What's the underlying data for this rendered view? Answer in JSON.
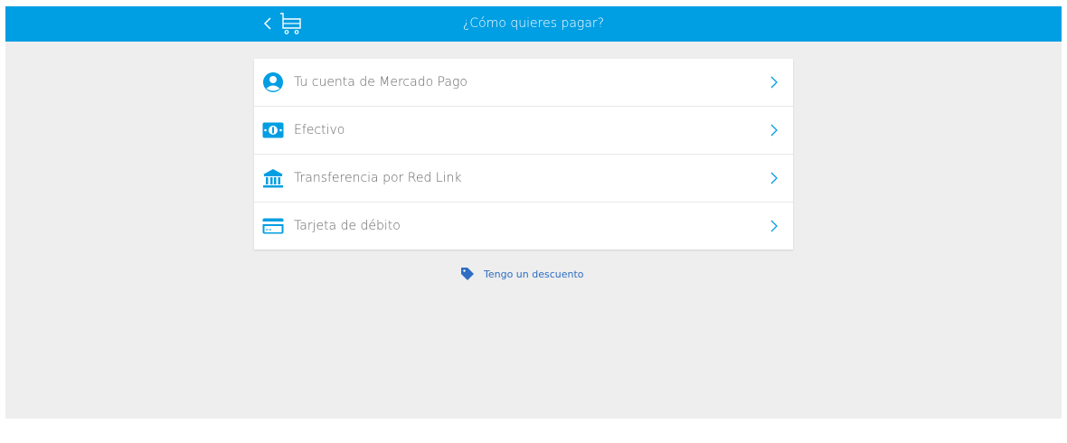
{
  "header": {
    "title": "¿Cómo quieres pagar?",
    "background_color": "#009ee3",
    "back_icon": "chevron-left-icon",
    "cart_icon": "cart-icon"
  },
  "payment_options": [
    {
      "label": "Tu cuenta de Mercado Pago",
      "icon": "account-icon"
    },
    {
      "label": "Efectivo",
      "icon": "cash-icon"
    },
    {
      "label": "Transferencia por Red Link",
      "icon": "bank-icon"
    },
    {
      "label": "Tarjeta de débito",
      "icon": "card-icon"
    }
  ],
  "discount": {
    "label": "Tengo un descuento",
    "icon": "tag-icon",
    "color": "#2d6ec2"
  },
  "accent_color": "#009ee3"
}
